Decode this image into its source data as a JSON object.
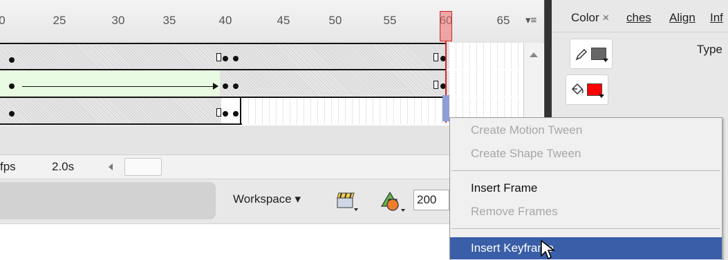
{
  "timeline": {
    "ruler_numbers": [
      "0",
      "25",
      "30",
      "35",
      "40",
      "45",
      "50",
      "55",
      "60",
      "65"
    ],
    "menu_icon": "panel-menu-icon"
  },
  "status": {
    "fps": "fps",
    "time": "2.0s"
  },
  "toolbar": {
    "workspace_label": "Workspace ▾",
    "zoom_value": "200"
  },
  "right_panel": {
    "tabs": [
      "Color",
      "ches",
      "Align",
      "Inf"
    ],
    "close_glyph": "×",
    "type_label": "Type",
    "stroke_icon": "pencil-icon",
    "fill_icon": "paint-bucket-icon",
    "stroke_color": "#666666",
    "fill_color": "#ff0000"
  },
  "context_menu": {
    "items": [
      {
        "label": "Create Motion Tween",
        "enabled": false
      },
      {
        "label": "Create Shape Tween",
        "enabled": false
      },
      {
        "label": "Insert Frame",
        "enabled": true
      },
      {
        "label": "Remove Frames",
        "enabled": false
      },
      {
        "label": "Insert Keyframe",
        "enabled": true,
        "highlighted": true
      }
    ]
  },
  "colors": {
    "playhead": "#dd2222",
    "highlight": "#3a5fa8",
    "tween_fill": "#e9fbe3"
  }
}
